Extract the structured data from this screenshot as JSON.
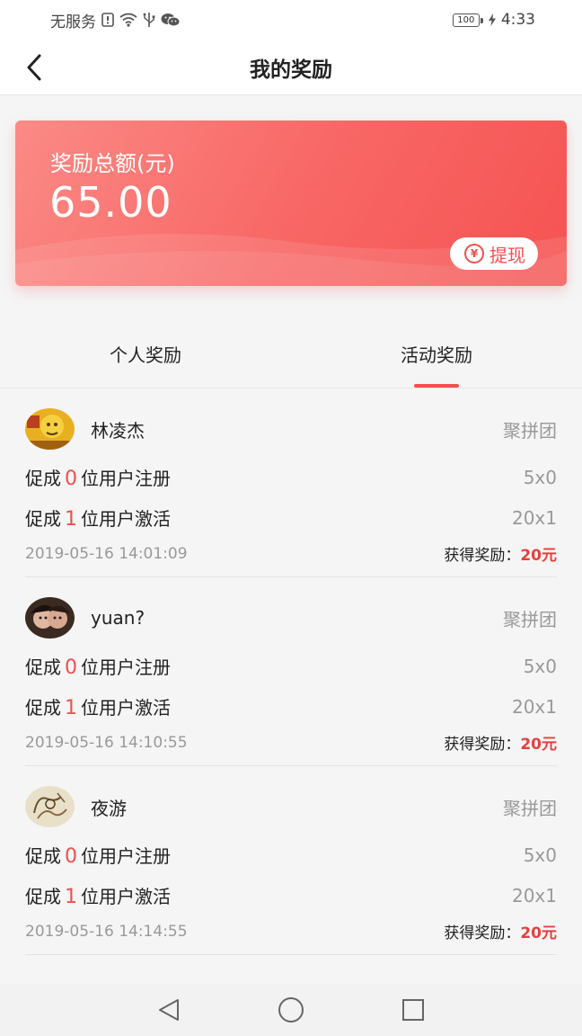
{
  "status_bar": {
    "carrier": "无服务",
    "battery": "100",
    "time": "4:33",
    "icons": [
      "sim-alert-icon",
      "wifi-icon",
      "usb-icon",
      "wechat-icon",
      "charging-icon"
    ]
  },
  "header": {
    "title": "我的奖励"
  },
  "reward_card": {
    "label": "奖励总额(元)",
    "amount": "65.00",
    "withdraw_label": "提现",
    "withdraw_icon": "yen-refresh-icon",
    "yen_symbol": "¥"
  },
  "tabs": [
    {
      "label": "个人奖励",
      "active": false
    },
    {
      "label": "活动奖励",
      "active": true
    }
  ],
  "records": [
    {
      "user": "林凌杰",
      "group": "聚拼团",
      "row1": {
        "prefix": "促成",
        "count": "0",
        "suffix": "位用户注册",
        "calc": "5x0"
      },
      "row2": {
        "prefix": "促成",
        "count": "1",
        "suffix": "位用户激活",
        "calc": "20x1"
      },
      "time": "2019-05-16 14:01:09",
      "earned_label": "获得奖励：",
      "earned_amount": "20元"
    },
    {
      "user": "yuan?",
      "group": "聚拼团",
      "row1": {
        "prefix": "促成",
        "count": "0",
        "suffix": "位用户注册",
        "calc": "5x0"
      },
      "row2": {
        "prefix": "促成",
        "count": "1",
        "suffix": "位用户激活",
        "calc": "20x1"
      },
      "time": "2019-05-16 14:10:55",
      "earned_label": "获得奖励：",
      "earned_amount": "20元"
    },
    {
      "user": "夜游",
      "group": "聚拼团",
      "row1": {
        "prefix": "促成",
        "count": "0",
        "suffix": "位用户注册",
        "calc": "5x0"
      },
      "row2": {
        "prefix": "促成",
        "count": "1",
        "suffix": "位用户激活",
        "calc": "20x1"
      },
      "time": "2019-05-16 14:14:55",
      "earned_label": "获得奖励：",
      "earned_amount": "20元"
    }
  ],
  "system_nav": [
    "back-triangle-icon",
    "home-circle-icon",
    "recents-square-icon"
  ],
  "colors": {
    "accent": "#f0504e",
    "card_start": "#fb8a86",
    "card_end": "#f55352"
  }
}
